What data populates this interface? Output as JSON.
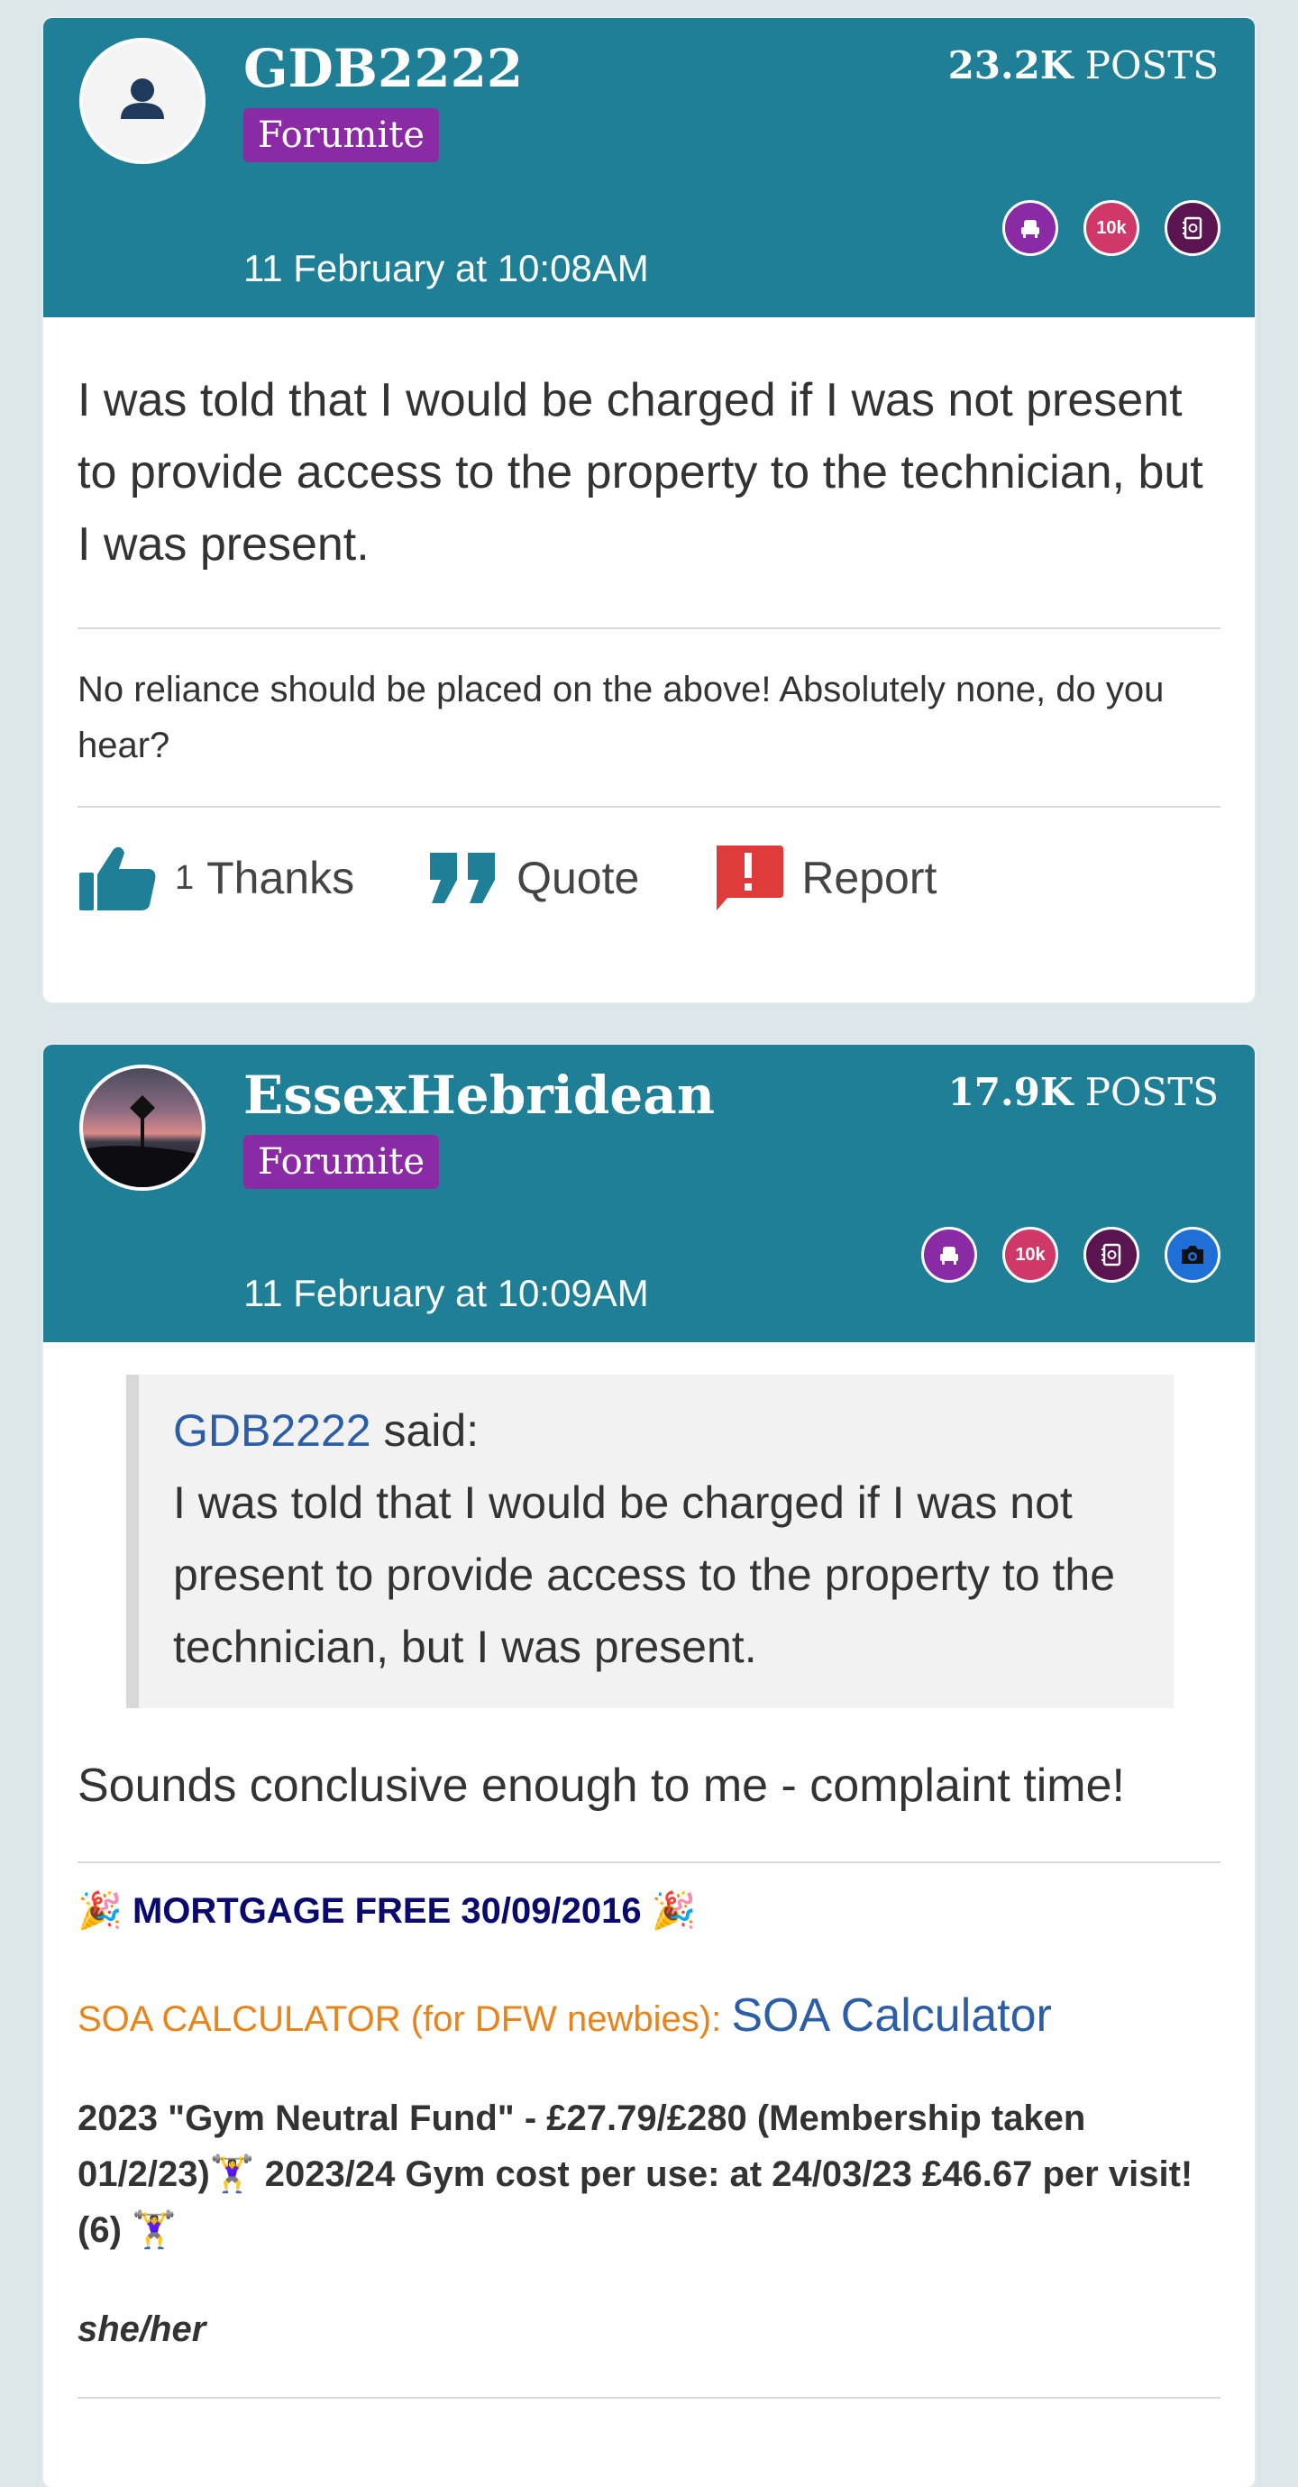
{
  "posts": [
    {
      "username": "GDB2222",
      "role": "Forumite",
      "posts_count_value": "23.2K",
      "posts_count_label": "POSTS",
      "timestamp": "11 February at 10:08AM",
      "badges": [
        "armchair-icon",
        "10k-badge",
        "address-book-icon"
      ],
      "badge_10k_text": "10k",
      "body": "I was told that I would be charged if I was not present to provide access to the property to the technician, but I was present.",
      "signature": "No reliance should be placed on the above! Absolutely none, do you hear?",
      "actions": {
        "thanks_count": "1",
        "thanks_label": "Thanks",
        "quote_label": "Quote",
        "report_label": "Report"
      }
    },
    {
      "username": "EssexHebridean",
      "role": "Forumite",
      "posts_count_value": "17.9K",
      "posts_count_label": "POSTS",
      "timestamp": "11 February at 10:09AM",
      "badges": [
        "armchair-icon",
        "10k-badge",
        "address-book-icon",
        "camera-icon"
      ],
      "badge_10k_text": "10k",
      "quote": {
        "author": "GDB2222",
        "said": "said:",
        "text": "I was told that I would be charged if I was not present to provide access to the property to the technician, but I was present."
      },
      "body": "Sounds conclusive enough to me - complaint time!",
      "signature": {
        "mortgage_free": "MORTGAGE FREE 30/09/2016",
        "soa_label": "SOA CALCULATOR (for DFW newbies):",
        "soa_link": "SOA Calculator",
        "gym_line_1": "2023 \"Gym Neutral Fund\" - £27.79/£280 (Membership taken 01/2/23)",
        "gym_line_2": "2023/24 Gym cost per use: at 24/03/23 £46.67 per visit! (6)",
        "pronouns": "she/her"
      }
    }
  ],
  "colors": {
    "header_bg": "#1e7f96",
    "role_badge_bg": "#8b2aa5",
    "link": "#2b5ea6",
    "soa_label": "#e8851a",
    "mortgage_text": "#0a0a6e",
    "page_bg": "#dde6e8"
  }
}
